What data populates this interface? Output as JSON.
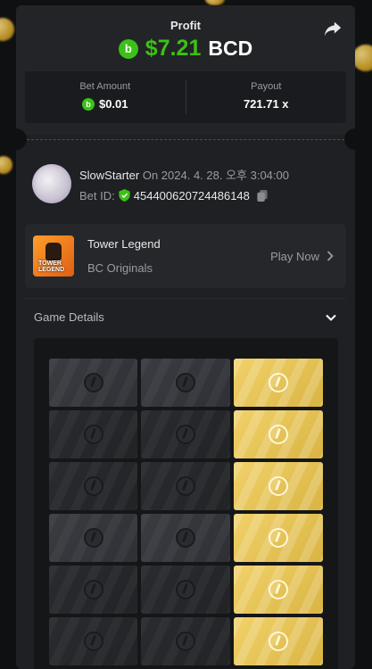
{
  "header": {
    "title": "Profit",
    "currency_icon": "bc-coin-icon",
    "profit_value": "$7.21",
    "profit_currency": "BCD",
    "colors": {
      "profit": "#3bc117",
      "background": "#1f2023"
    }
  },
  "stats": {
    "bet_label": "Bet Amount",
    "bet_value": "$0.01",
    "payout_label": "Payout",
    "payout_value": "721.71 x"
  },
  "user": {
    "name": "SlowStarter",
    "on_label": "On",
    "datetime": "2024. 4. 28. 오후 3:04:00",
    "bet_id_label": "Bet ID:",
    "bet_id": "454400620724486148"
  },
  "game": {
    "name": "Tower Legend",
    "provider": "BC Originals",
    "play_label": "Play Now",
    "thumb_text": "TOWER LEGEND"
  },
  "details": {
    "title": "Game Details"
  },
  "board": {
    "rows": [
      [
        "dark",
        "dark",
        "gold"
      ],
      [
        "dim",
        "dim",
        "gold"
      ],
      [
        "dim",
        "dim",
        "gold"
      ],
      [
        "dark",
        "dark",
        "gold"
      ],
      [
        "dim",
        "dim",
        "gold"
      ],
      [
        "dim",
        "dim",
        "gold"
      ]
    ]
  }
}
